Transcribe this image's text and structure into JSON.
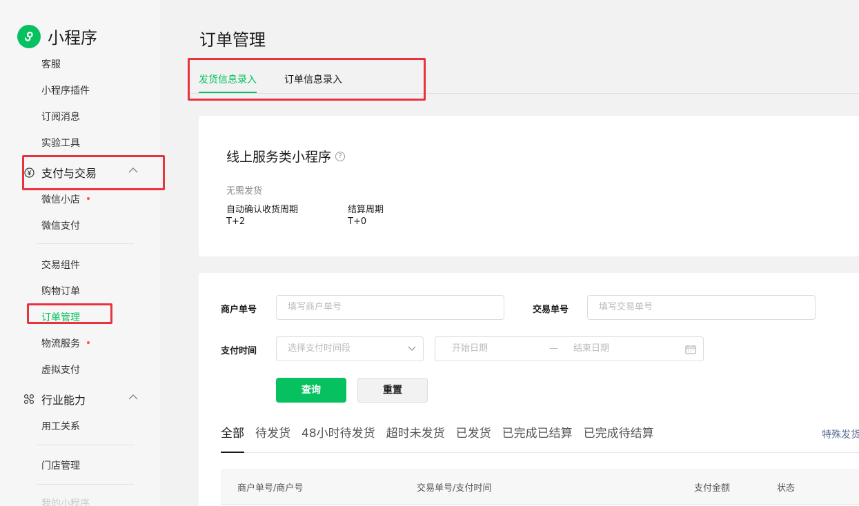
{
  "sidebar": {
    "logo_text": "小程序",
    "items_top": [
      "客服",
      "小程序插件",
      "订阅消息",
      "实验工具"
    ],
    "group_payment": "支付与交易",
    "payment_items_a": [
      "微信小店",
      "微信支付"
    ],
    "payment_items_b": [
      "交易组件",
      "购物订单",
      "订单管理",
      "物流服务",
      "虚拟支付"
    ],
    "group_industry": "行业能力",
    "industry_items": [
      "用工关系"
    ],
    "store_item": "门店管理",
    "cut_item": "我的小程序"
  },
  "page": {
    "title": "订单管理",
    "tabs": [
      "发货信息录入",
      "订单信息录入"
    ]
  },
  "summary": {
    "title": "线上服务类小程序",
    "help_glyph": "?",
    "no_shipping": "无需发货",
    "auto_confirm_label": "自动确认收货周期",
    "auto_confirm_value": "T+2",
    "settle_label": "结算周期",
    "settle_value": "T+0"
  },
  "filters": {
    "merchant_no_label": "商户单号",
    "merchant_no_placeholder": "填写商户单号",
    "trade_no_label": "交易单号",
    "trade_no_placeholder": "填写交易单号",
    "pay_time_label": "支付时间",
    "pay_time_select": "选择支付时间段",
    "start_date": "开始日期",
    "date_sep": "—",
    "end_date": "结束日期",
    "query_button": "查询",
    "reset_button": "重置"
  },
  "status_tabs": [
    "全部",
    "待发货",
    "48小时待发货",
    "超时未发货",
    "已发货",
    "已完成已结算",
    "已完成待结算"
  ],
  "special_link": "特殊发货",
  "table_headers": [
    "商户单号/商户号",
    "交易单号/支付时间",
    "支付金额",
    "状态"
  ],
  "colors": {
    "brand": "#07c160",
    "highlight": "#e8323c",
    "link": "#576b95",
    "red_dot": "#fa5151"
  }
}
